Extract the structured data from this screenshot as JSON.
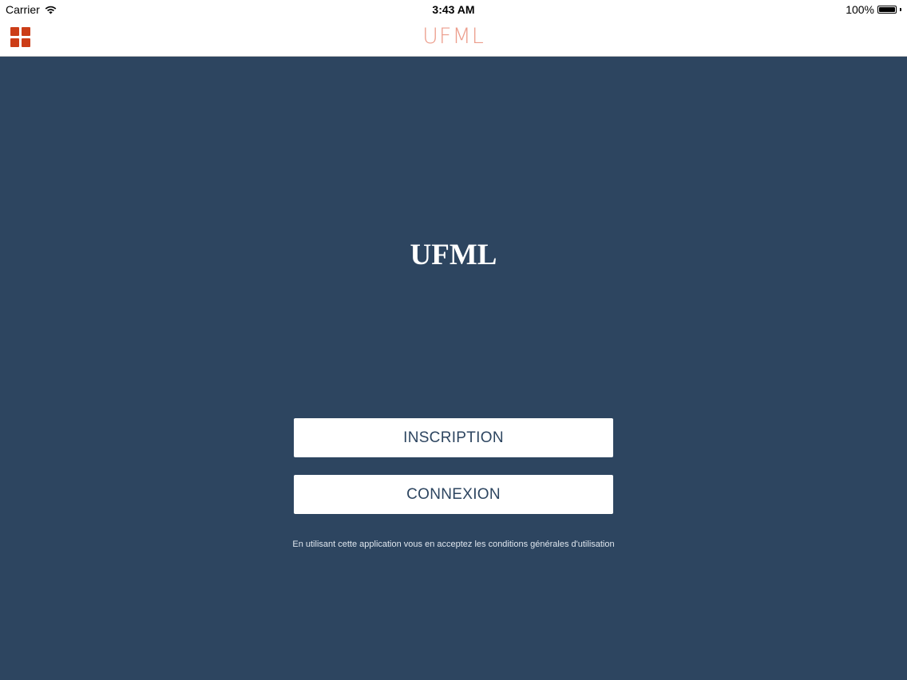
{
  "status_bar": {
    "carrier": "Carrier",
    "time": "3:43 AM",
    "battery": "100%",
    "battery_level": 1.0
  },
  "nav": {
    "title": "UFML",
    "menu_icon": "grid-icon"
  },
  "main": {
    "brand": "UFML",
    "inscription_label": "INSCRIPTION",
    "connexion_label": "CONNEXION",
    "terms": "En utilisant cette application vous en acceptez les conditions générales d'utilisation"
  },
  "colors": {
    "background": "#2d4560",
    "accent": "#cc3d17",
    "nav_title": "#ec9d8c"
  }
}
